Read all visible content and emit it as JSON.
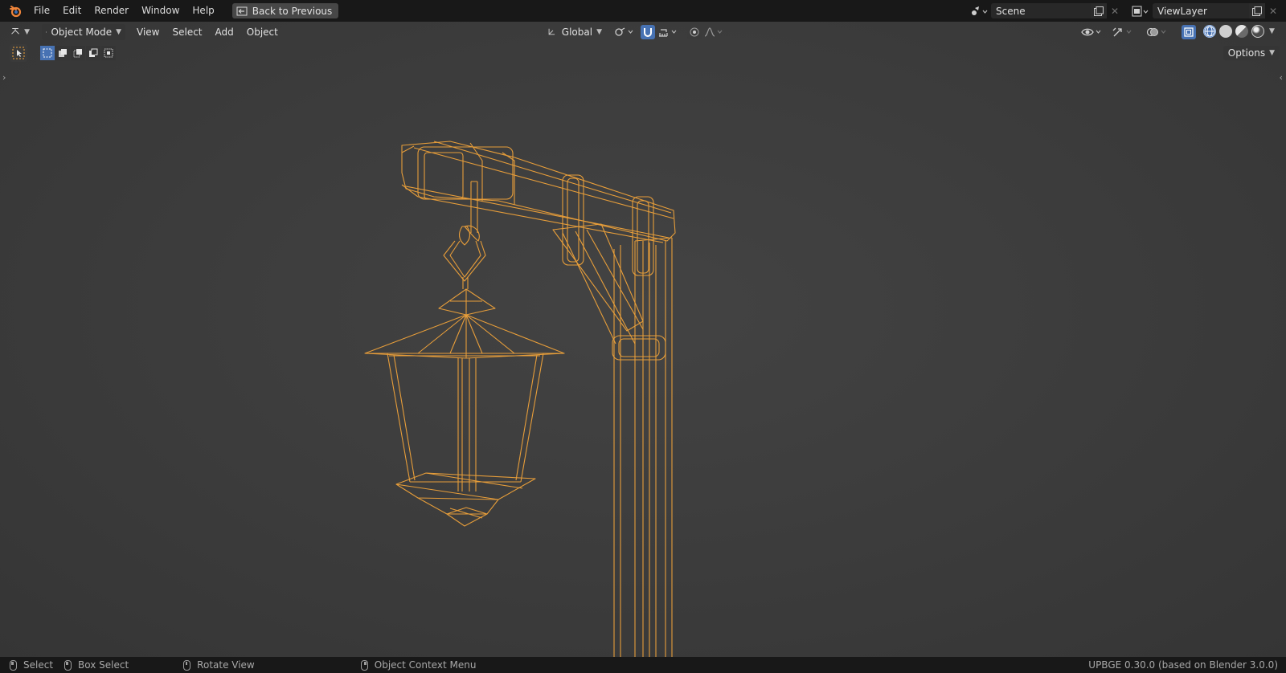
{
  "topbar": {
    "menus": [
      "File",
      "Edit",
      "Render",
      "Window",
      "Help"
    ],
    "back_button": "Back to Previous",
    "scene_name": "Scene",
    "view_layer_name": "ViewLayer"
  },
  "viewport_header": {
    "mode": "Object Mode",
    "menus": [
      "View",
      "Select",
      "Add",
      "Object"
    ],
    "transform_orientation": "Global",
    "options_label": "Options"
  },
  "statusbar": {
    "select": "Select",
    "box_select": "Box Select",
    "rotate_view": "Rotate View",
    "context_menu": "Object Context Menu",
    "version": "UPBGE 0.30.0 (based on Blender 3.0.0)"
  },
  "colors": {
    "selection_orange": "#f0a33a",
    "active_blue": "#4772b3"
  }
}
